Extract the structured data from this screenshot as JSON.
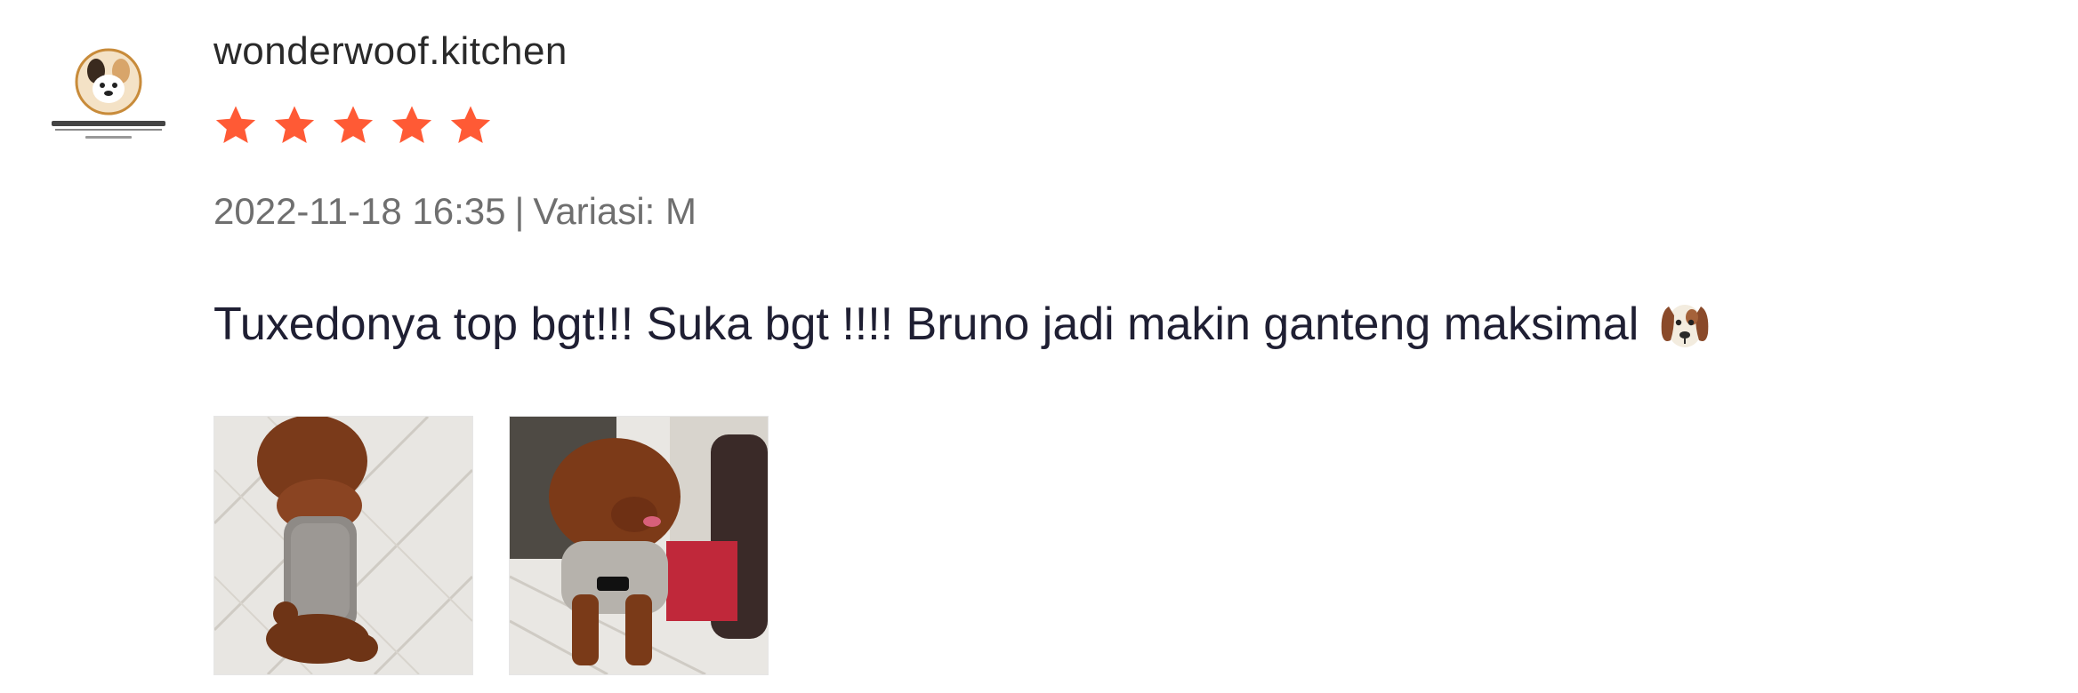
{
  "review": {
    "username": "wonderwoof.kitchen",
    "avatar_icon": "wonderwoof-kitchen-logo",
    "rating": 5,
    "star_color": "#ff5a35",
    "date": "2022-11-18 16:35",
    "separator": "|",
    "variation": "Variasi: M",
    "comment": "Tuxedonya top bgt!!! Suka bgt !!!! Bruno jadi makin ganteng maksimal",
    "comment_emoji": "dog-face-emoji",
    "photos": [
      {
        "icon": "review-photo-dog-side"
      },
      {
        "icon": "review-photo-dog-front"
      }
    ]
  }
}
